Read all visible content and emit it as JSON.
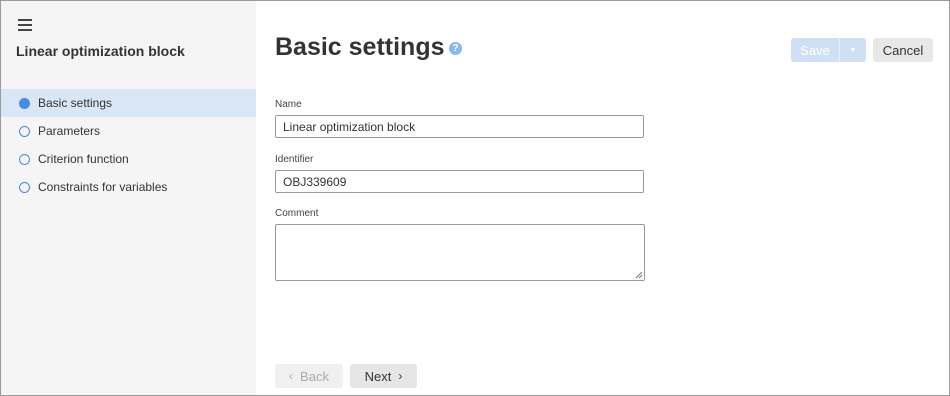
{
  "sidebar": {
    "menu_icon": "hamburger-menu-icon",
    "title": "Linear optimization block",
    "steps": [
      {
        "label": "Basic settings",
        "active": true
      },
      {
        "label": "Parameters",
        "active": false
      },
      {
        "label": "Criterion function",
        "active": false
      },
      {
        "label": "Constraints for variables",
        "active": false
      }
    ]
  },
  "header": {
    "title": "Basic settings",
    "help_icon": "?",
    "save_label": "Save",
    "cancel_label": "Cancel"
  },
  "form": {
    "name_label": "Name",
    "name_value": "Linear optimization block",
    "identifier_label": "Identifier",
    "identifier_value": "OBJ339609",
    "comment_label": "Comment",
    "comment_value": ""
  },
  "footer": {
    "back_label": "Back",
    "next_label": "Next"
  },
  "colors": {
    "accent": "#4a8ae0",
    "active_step_bg": "#d9e6f6",
    "save_disabled": "#cfe0f6"
  }
}
